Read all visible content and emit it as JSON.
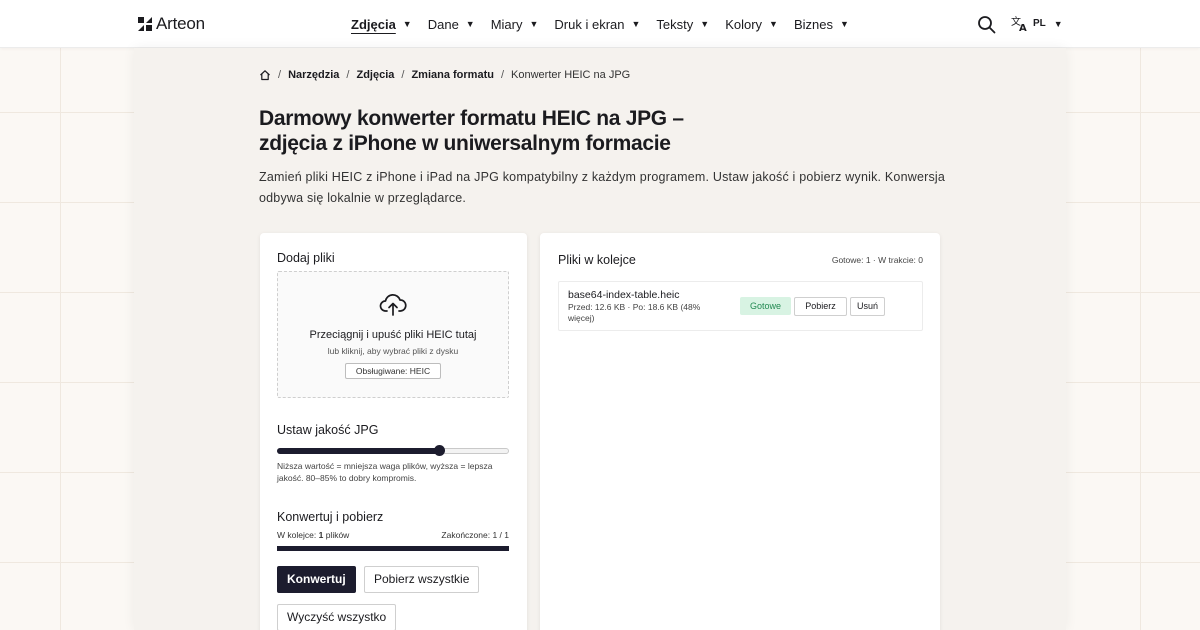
{
  "brand": {
    "name": "Arteon"
  },
  "nav": {
    "items": [
      {
        "label": "Zdjęcia"
      },
      {
        "label": "Dane"
      },
      {
        "label": "Miary"
      },
      {
        "label": "Druk i ekran"
      },
      {
        "label": "Teksty"
      },
      {
        "label": "Kolory"
      },
      {
        "label": "Biznes"
      }
    ],
    "active": "Zdjęcia",
    "lang_code": "PL"
  },
  "breadcrumb": {
    "links": [
      "Narzędzia",
      "Zdjęcia",
      "Zmiana formatu"
    ],
    "current": "Konwerter HEIC na JPG",
    "separator": "/"
  },
  "page": {
    "title_line1": "Darmowy konwerter formatu HEIC na JPG –",
    "title_line2": "zdjęcia z iPhone w uniwersalnym formacie",
    "lead_line1": "Zamień pliki HEIC z iPhone i iPad na JPG kompatybilny z każdym programem. Ustaw jakość i pobierz wynik. Konwersja",
    "lead_line2": "odbywa się lokalnie w przeglądarce."
  },
  "upload": {
    "heading": "Dodaj pliki",
    "drop_main": "Przeciągnij i upuść pliki HEIC tutaj",
    "drop_sub": "lub kliknij, aby wybrać pliki z dysku",
    "supported": "Obsługiwane: HEIC"
  },
  "quality": {
    "heading": "Ustaw jakość JPG",
    "value_fraction": 0.7,
    "hint": "Niższa wartość = mniejsza waga plików, wyższa = lepsza jakość. 80–85% to dobry kompromis."
  },
  "convert": {
    "heading": "Konwertuj i pobierz",
    "queue_prefix": "W kolejce:",
    "queue_count": "1",
    "queue_suffix": "plików",
    "done_text": "Zakończone: 1 / 1",
    "progress_fraction": 1.0,
    "convert_btn": "Konwertuj",
    "download_all_btn": "Pobierz wszystkie",
    "clear_all_btn": "Wyczyść wszystko"
  },
  "queue": {
    "heading": "Pliki w kolejce",
    "status": "Gotowe: 1 · W trakcie: 0",
    "files": [
      {
        "name": "base64-index-table.heic",
        "info": "Przed: 12.6 KB · Po: 18.6 KB (48% więcej)",
        "status": "Gotowe",
        "download_btn": "Pobierz",
        "remove_btn": "Usuń"
      }
    ]
  },
  "colors": {
    "accent_dark": "#1c1c2e",
    "success_bg": "#d8f3e3",
    "success_text": "#238a52"
  }
}
